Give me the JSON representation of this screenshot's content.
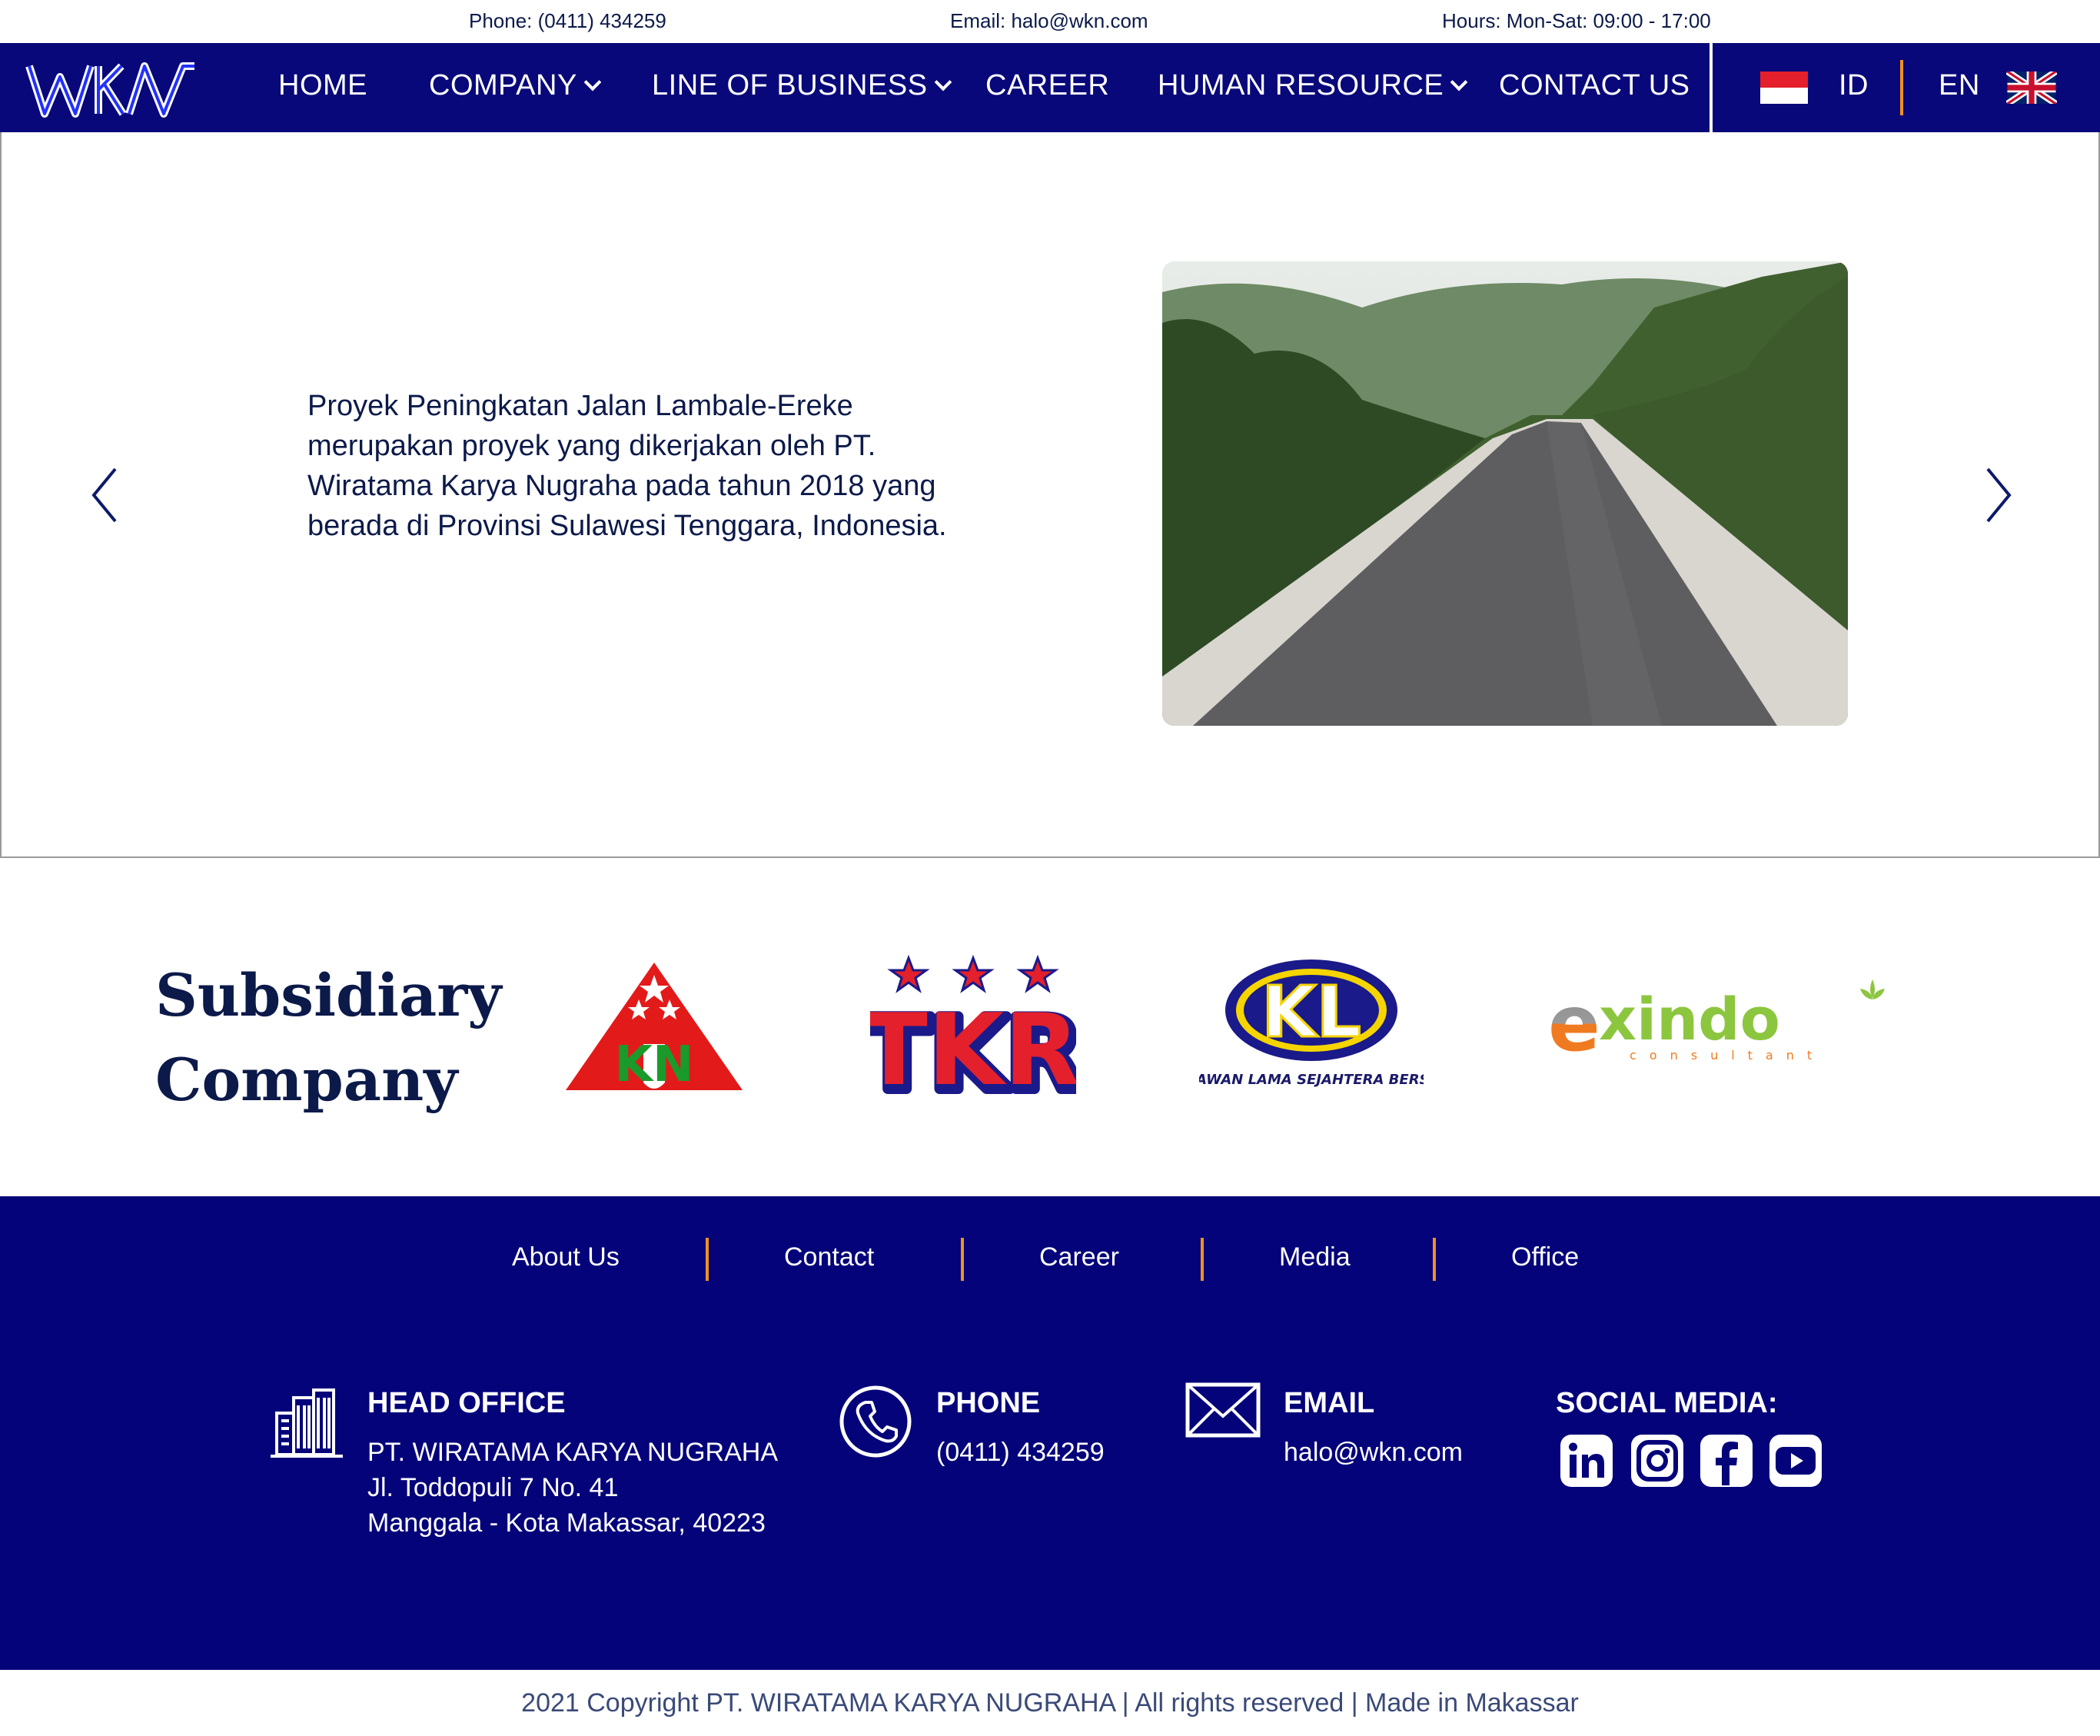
{
  "topbar": {
    "phone": "Phone: (0411) 434259",
    "email": "Email: halo@wkn.com",
    "hours": "Hours: Mon-Sat: 09:00 - 17:00"
  },
  "nav": {
    "items": [
      {
        "label": "HOME"
      },
      {
        "label": "COMPANY"
      },
      {
        "label": "LINE OF BUSINESS"
      },
      {
        "label": "CAREER"
      },
      {
        "label": "HUMAN RESOURCE"
      },
      {
        "label": "CONTACT US"
      }
    ],
    "lang_id": "ID",
    "lang_en": "EN"
  },
  "hero": {
    "text": "Proyek Peningkatan Jalan Lambale-Ereke merupakan proyek yang dikerjakan oleh  PT. Wiratama Karya Nugraha pada tahun 2018  yang berada di Provinsi Sulawesi Tenggara, Indonesia."
  },
  "subsidiary": {
    "title_line1": "Subsidiary",
    "title_line2": "Company",
    "logos": [
      {
        "name": "KN",
        "color": "#e31a1a"
      },
      {
        "name": "TKR",
        "color": "#e3202b"
      },
      {
        "name": "KL",
        "caption": "PT. KAWAN LAMA SEJAHTERA BERSAMA"
      },
      {
        "name": "exindo",
        "sub": "consultant"
      }
    ]
  },
  "footer": {
    "links": [
      "About Us",
      "Contact",
      "Career",
      "Media",
      "Office"
    ],
    "head_office": {
      "title": "HEAD OFFICE",
      "line1": "PT. WIRATAMA KARYA NUGRAHA",
      "line2": "Jl. Toddopuli 7 No. 41",
      "line3": "Manggala - Kota Makassar, 40223"
    },
    "phone": {
      "title": "PHONE",
      "value": "(0411) 434259"
    },
    "email": {
      "title": "EMAIL",
      "value": "halo@wkn.com"
    },
    "social": {
      "title": "SOCIAL MEDIA:"
    }
  },
  "copyright": "2021 Copyright PT. WIRATAMA KARYA NUGRAHA |  All rights reserved | Made in Makassar",
  "colors": {
    "navy": "#08087a",
    "footer": "#04037a",
    "accent": "#f0921e"
  }
}
